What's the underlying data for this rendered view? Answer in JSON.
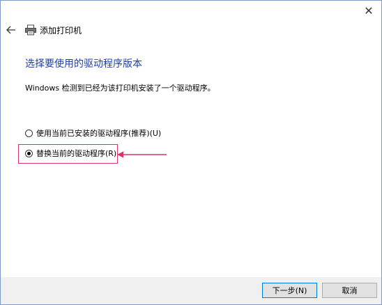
{
  "window": {
    "close_glyph": "✕"
  },
  "header": {
    "title": "添加打印机",
    "back_icon": "back-arrow-icon",
    "printer_icon": "printer-icon"
  },
  "main": {
    "heading": "选择要使用的驱动程序版本",
    "description": "Windows 检测到已经为该打印机安装了一个驱动程序。",
    "options": [
      {
        "label": "使用当前已安装的驱动程序(推荐)(U)",
        "selected": false
      },
      {
        "label": "替换当前的驱动程序(R)",
        "selected": true
      }
    ]
  },
  "annotation": {
    "color": "#e0306a"
  },
  "footer": {
    "next_label": "下一步(N)",
    "cancel_label": "取消"
  },
  "colors": {
    "heading": "#1f3fa6",
    "button_focus": "#0078d7"
  }
}
